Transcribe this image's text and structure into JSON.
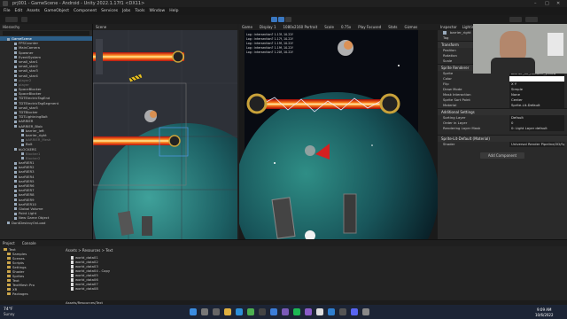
{
  "window": {
    "title": "prj001 - GameScene - Android - Unity 2022.1.17f1 <DX11>"
  },
  "menu": [
    "File",
    "Edit",
    "Assets",
    "GameObject",
    "Component",
    "Services",
    "Jobs",
    "Tools",
    "Window",
    "Help"
  ],
  "hierarchy": {
    "tab": "Hierarchy",
    "items": [
      {
        "label": "GameScene",
        "indent": 1,
        "state": "sel"
      },
      {
        "label": "FPSCounter",
        "indent": 2
      },
      {
        "label": "MainCamera",
        "indent": 2
      },
      {
        "label": "Spawner",
        "indent": 2
      },
      {
        "label": "EventSystem",
        "indent": 2
      },
      {
        "label": "small_star1",
        "indent": 2
      },
      {
        "label": "small_star2",
        "indent": 2
      },
      {
        "label": "small_star3",
        "indent": 2
      },
      {
        "label": "small_star4",
        "indent": 2
      },
      {
        "label": "player2",
        "indent": 2,
        "state": "dim"
      },
      {
        "label": "player",
        "indent": 2,
        "state": "dim"
      },
      {
        "label": "SpaceBlocker",
        "indent": 2
      },
      {
        "label": "SpaceBlocker",
        "indent": 2
      },
      {
        "label": "TDTElectricTagEnd",
        "indent": 2
      },
      {
        "label": "TDTElectricTagSegment",
        "indent": 2
      },
      {
        "label": "small_star5",
        "indent": 2
      },
      {
        "label": "TDTBlocker",
        "indent": 2
      },
      {
        "label": "TDTLightningBolt",
        "indent": 2
      },
      {
        "label": "bARRIER",
        "indent": 2
      },
      {
        "label": "bARRIER_Blob",
        "indent": 2
      },
      {
        "label": "barrier_left",
        "indent": 3
      },
      {
        "label": "barrier_right",
        "indent": 3
      },
      {
        "label": "bARRIER_Mesh",
        "indent": 3,
        "state": "dim"
      },
      {
        "label": "Bolt",
        "indent": 3
      },
      {
        "label": "bLOCKERS",
        "indent": 2
      },
      {
        "label": "Blocker1",
        "indent": 3,
        "state": "dim"
      },
      {
        "label": "Blocker2",
        "indent": 3,
        "state": "dim"
      },
      {
        "label": "barRIER1",
        "indent": 2
      },
      {
        "label": "barRIER2",
        "indent": 2
      },
      {
        "label": "barRIER3",
        "indent": 2
      },
      {
        "label": "barRIER4",
        "indent": 2
      },
      {
        "label": "barRIER5",
        "indent": 2
      },
      {
        "label": "barRIER6",
        "indent": 2
      },
      {
        "label": "barRIER7",
        "indent": 2
      },
      {
        "label": "barRIER8",
        "indent": 2
      },
      {
        "label": "barRIER9",
        "indent": 2
      },
      {
        "label": "barRIER10",
        "indent": 2
      },
      {
        "label": "Global Volume",
        "indent": 2
      },
      {
        "label": "Point Light",
        "indent": 2
      },
      {
        "label": "New Game Object",
        "indent": 2
      },
      {
        "label": "DontDestroyOnLoad",
        "indent": 1
      }
    ]
  },
  "scene": {
    "tab": "Scene",
    "shading": "2D"
  },
  "game": {
    "tab": "Game",
    "display": "Display 1",
    "resolution": "1080x2160 Portrait",
    "scale": "Scale",
    "scale_value": "0.75x",
    "stats": [
      "Play Focused",
      "Stats",
      "Gizmos"
    ],
    "log": [
      "Log : intersection? 1.13f, 10.22f",
      "Log : intersection? 1.17f, 10.22f",
      "Log : intersection? 1.19f, 10.22f",
      "Log : intersection? 1.19f, 10.22f",
      "Log : intersection? 1.20f, 10.22f"
    ]
  },
  "inspector": {
    "tab": "Inspector",
    "tab2": "Lighting",
    "object_name": "barrier_right",
    "tag_label": "Tag",
    "tag": "Untagged",
    "transform": "Transform",
    "transform_rows": [
      "Position",
      "Rotation",
      "Scale"
    ],
    "sprite_renderer": "Sprite Renderer",
    "rows": [
      {
        "k": "Sprite",
        "v": "barrier_02_metallic_yellow"
      },
      {
        "k": "Color",
        "v": ""
      },
      {
        "k": "Flip",
        "v": "X  Y"
      },
      {
        "k": "Draw Mode",
        "v": "Simple"
      },
      {
        "k": "Mask Interaction",
        "v": "None"
      },
      {
        "k": "Sprite Sort Point",
        "v": "Center"
      },
      {
        "k": "Material",
        "v": "Sprite-Lit-Default"
      }
    ],
    "additional": "Additional Settings",
    "rows2": [
      {
        "k": "Sorting Layer",
        "v": "Default"
      },
      {
        "k": "Order in Layer",
        "v": "0"
      },
      {
        "k": "Rendering Layer Mask",
        "v": "0: Light Layer default"
      }
    ],
    "material_name": "Sprite-Lit-Default (Material)",
    "shader_label": "Shader",
    "shader": "Universal Render Pipeline/2D/Sprite-Lit-Default",
    "add_component": "Add Component"
  },
  "bottom": {
    "tabs": [
      "Project",
      "Console"
    ],
    "breadcrumb": "Assets > Resources > Text",
    "tree": [
      "Text",
      "Samples",
      "Scenes",
      "Scripts",
      "Settings",
      "Shader",
      "Sprites",
      "Text",
      "TextMesh Pro",
      "XR",
      "Packages"
    ],
    "files": [
      "world_data01",
      "world_data02",
      "world_data03",
      "world_data04 - Copy",
      "world_data05",
      "world_data06",
      "world_data07",
      "world_data08"
    ],
    "status": "Assets/Resources/Text"
  },
  "taskbar": {
    "weather_temp": "74°F",
    "weather_text": "Sunny",
    "time": "9:09 AM",
    "date": "10/6/2022",
    "icons": [
      "windows-start",
      "search",
      "taskview",
      "explorer",
      "edge",
      "chrome",
      "store",
      "mail",
      "photos",
      "spotify",
      "visual-studio",
      "unity",
      "vs-code",
      "obs",
      "discord",
      "settings"
    ]
  }
}
